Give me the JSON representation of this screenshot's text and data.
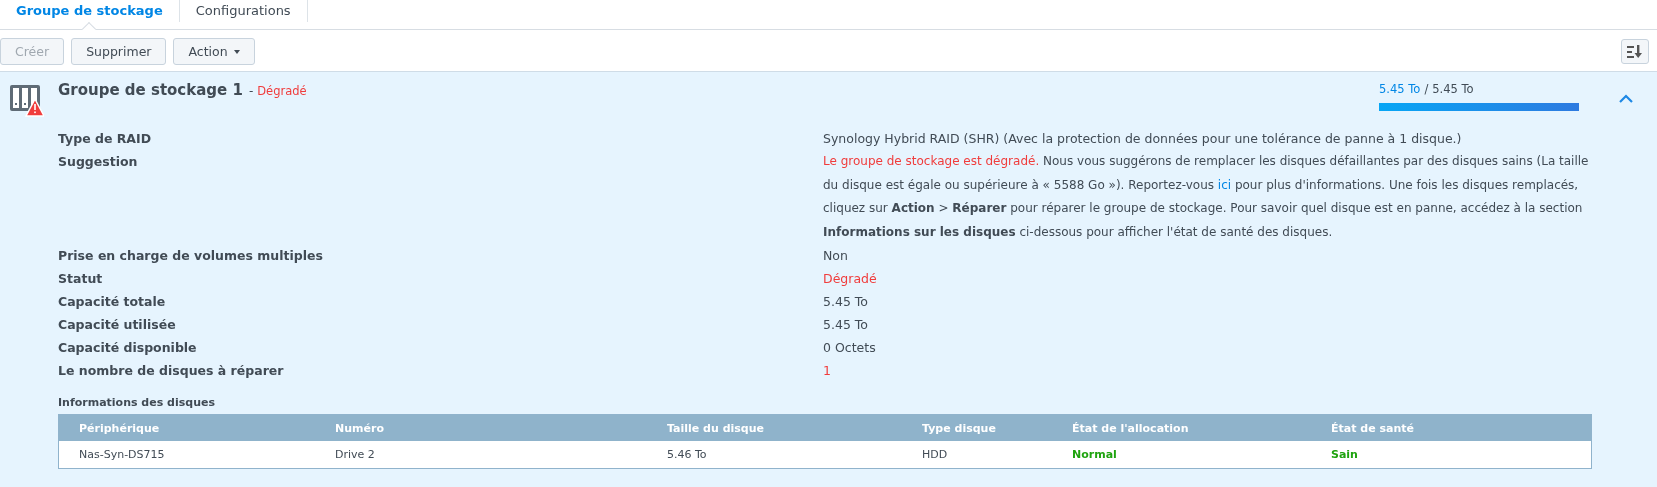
{
  "tabs": [
    {
      "label": "Groupe de stockage",
      "selected": true
    },
    {
      "label": "Configurations",
      "selected": false
    }
  ],
  "toolbar": {
    "buttons": [
      {
        "label": "Créer",
        "disabled": true,
        "kind": "plain"
      },
      {
        "label": "Supprimer",
        "disabled": false,
        "kind": "plain"
      },
      {
        "label": "Action",
        "disabled": false,
        "kind": "dropdown"
      }
    ]
  },
  "pool": {
    "title": "Groupe de stockage 1",
    "separator": "-",
    "status": "Dégradé",
    "warning": true,
    "expanded": true,
    "capacity": {
      "used": "5.45 To",
      "divider": "/",
      "total": "5.45 To",
      "level": 1
    },
    "details": [
      {
        "label": "Type de RAID",
        "value": "Synology Hybrid RAID (SHR) (Avec la protection de données pour une tolérance de panne à 1 disque.)"
      },
      {
        "label": "Suggestion",
        "segments": [
          {
            "kind": "alert",
            "text": "Le groupe de stockage est dégradé."
          },
          {
            "kind": "text",
            "text": " Nous vous suggérons de remplacer les disques défaillantes par des disques sains (La taille du disque est égale ou supérieure à « 5588 Go »). Reportez-vous "
          },
          {
            "kind": "link",
            "text": "ici"
          },
          {
            "kind": "text",
            "text": " pour plus d'informations. Une fois les disques remplacés, cliquez sur **Action** > **Réparer** pour réparer le groupe de stockage. Pour savoir quel disque est en panne, accédez à la section **Informations sur les disques** ci-dessous pour afficher l'état de santé des disques."
          }
        ]
      },
      {
        "label": "Prise en charge de volumes multiples",
        "value": "Non"
      },
      {
        "label": "Statut",
        "value": "Dégradé",
        "alert": true
      },
      {
        "label": "Capacité totale",
        "value": "5.45 To"
      },
      {
        "label": "Capacité utilisée",
        "value": "5.45 To"
      },
      {
        "label": "Capacité disponible",
        "value": "0 Octets"
      },
      {
        "label": "Le nombre de disques à réparer",
        "value": "1",
        "alert": true
      }
    ],
    "disks": {
      "title": "Informations des disques",
      "columns": [
        "Périphérique",
        "Numéro",
        "Taille du disque",
        "Type disque",
        "État de l'allocation",
        "État de santé"
      ],
      "rows": [
        [
          {
            "text": "Nas-Syn-DS715"
          },
          {
            "text": "Drive 2"
          },
          {
            "text": "5.46 To"
          },
          {
            "text": "HDD"
          },
          {
            "text": "Normal",
            "healthy": true
          },
          {
            "text": "Sain",
            "healthy": true
          }
        ]
      ]
    }
  }
}
